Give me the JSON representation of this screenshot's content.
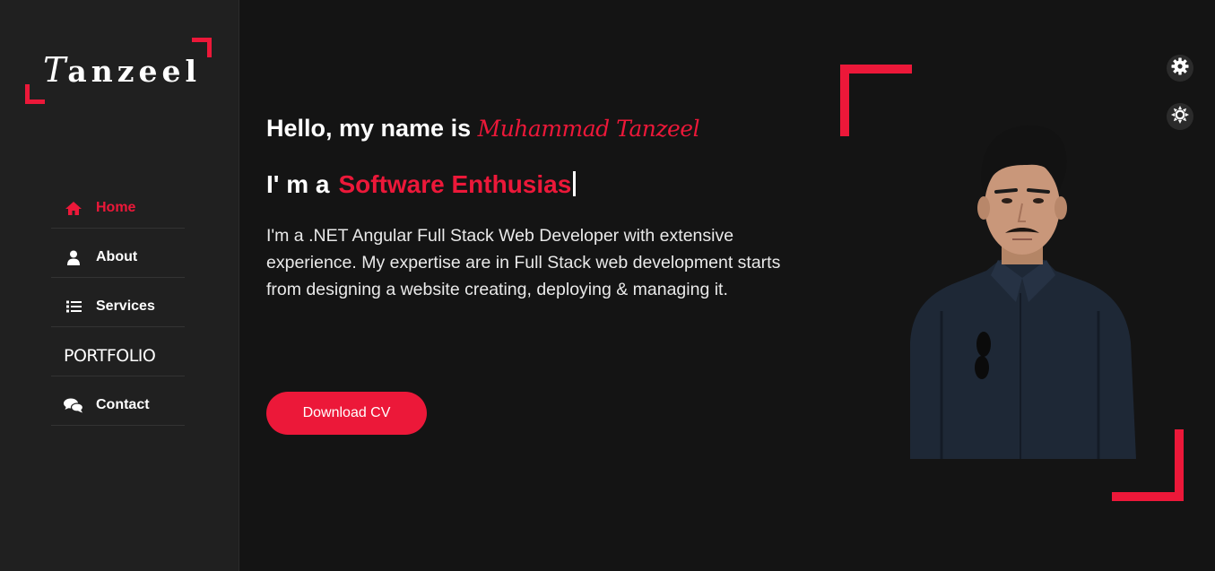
{
  "brand": {
    "logo_initial": "T",
    "logo_rest": "anzeel"
  },
  "nav": {
    "items": [
      {
        "label": "Home",
        "icon": "home-icon",
        "active": true
      },
      {
        "label": "About",
        "icon": "user-icon",
        "active": false
      },
      {
        "label": "Services",
        "icon": "list-icon",
        "active": false
      },
      {
        "label": "PORTFOLIO",
        "icon": "",
        "active": false
      },
      {
        "label": "Contact",
        "icon": "comments-icon",
        "active": false
      }
    ]
  },
  "hero": {
    "greeting": "Hello, my name is",
    "name": "Muhammad Tanzeel",
    "role_prefix": "I' m a",
    "role_typed": "Software Enthusias",
    "bio": "I'm a .NET Angular Full Stack Web Developer with extensive experience. My expertise are in Full Stack web development starts from designing a website creating, deploying & managing it.",
    "cta_label": "Download CV"
  },
  "toggles": [
    {
      "icon": "gear-icon"
    },
    {
      "icon": "sun-icon"
    }
  ],
  "colors": {
    "accent": "#ec1839",
    "background": "#141414",
    "sidebar": "#202020",
    "text": "#e9e9e9"
  }
}
